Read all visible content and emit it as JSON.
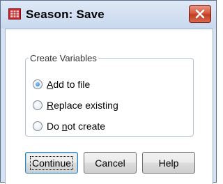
{
  "window": {
    "title": "Season: Save",
    "icon": "data-grid-icon",
    "close_icon": "close-icon",
    "colors": {
      "close_button": "#d65a3f",
      "title_bar": "#d6e1f1",
      "app_icon": "#d2232a"
    }
  },
  "group": {
    "legend": "Create Variables",
    "options": [
      {
        "label": "Add to file",
        "mnemonic": "A",
        "rest": "dd to file",
        "checked": true
      },
      {
        "label": "Replace existing",
        "mnemonic": "R",
        "rest": "eplace existing",
        "checked": false
      },
      {
        "label": "Do not create",
        "before": "Do ",
        "mnemonic": "n",
        "rest": "ot create",
        "checked": false
      }
    ]
  },
  "buttons": {
    "continue": "Continue",
    "cancel": "Cancel",
    "help": "Help"
  }
}
